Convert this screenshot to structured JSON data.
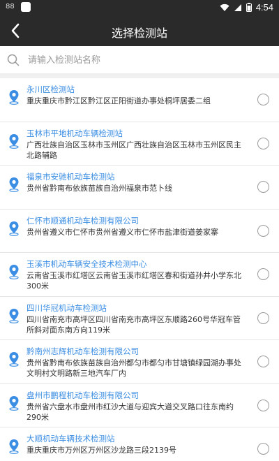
{
  "status_bar": {
    "left_text": "88",
    "time": "4:54",
    "icons": [
      "wifi-icon",
      "signal-icon",
      "battery-icon"
    ]
  },
  "nav": {
    "title": "选择检测站",
    "back_icon": "chevron-left-icon"
  },
  "search": {
    "placeholder": "请输入检测站名称",
    "value": ""
  },
  "colors": {
    "bar_bg": "#2a2a2a",
    "accent_blue": "#3b8ee3",
    "text_dark": "#333333",
    "divider": "#e6e6e6"
  },
  "stations": [
    {
      "name": "永川区检测站",
      "address": "重庆重庆市黔江区黔江区正阳街道办事处桐坪居委二组",
      "selected": false
    },
    {
      "name": "玉林市平地机动车辆检测站",
      "address": "广西壮族自治区玉林市玉州区广西壮族自治区玉林市玉州区民主北路辅路",
      "selected": false
    },
    {
      "name": "福泉市安驰机动车检测站",
      "address": "贵州省黔南布依族苗族自治州福泉市范卜线",
      "selected": false
    },
    {
      "name": "仁怀市顺通机动车检测有限公司",
      "address": "贵州省遵义市仁怀市贵州省遵义市仁怀市盐津街道姜家寨",
      "selected": false
    },
    {
      "name": "玉溪市机动车辆安全技术检测中心",
      "address": "云南省玉溪市红塔区云南省玉溪市红塔区春和街道孙井小学东北300米",
      "selected": false
    },
    {
      "name": "四川华冠机动车检测站",
      "address": "四川省南充市高坪区四川省南充市高坪区东顺路260号华冠车管所斜对面东南方向119米",
      "selected": false
    },
    {
      "name": "黔南州志辉机动车检测有限公司",
      "address": "贵州省黔南布依族苗族自治州都匀市都匀市甘塘镇绿园湖办事处文明村文明路新三地汽车厂内",
      "selected": false
    },
    {
      "name": "盘州市鹏程机动车检测有限公司",
      "address": "贵州省六盘水市盘州市红沙大道与迎宾大道交叉路口往东南约290米",
      "selected": false
    },
    {
      "name": "大顺机动车辆技术检测站",
      "address": "重庆重庆市万州区万州区沙龙路三段2139号",
      "selected": false
    }
  ]
}
